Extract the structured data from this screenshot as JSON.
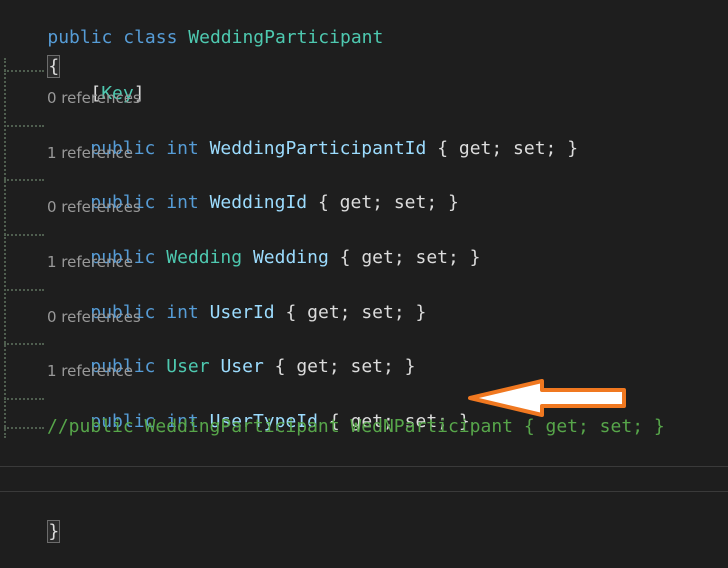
{
  "code": {
    "class_decl": {
      "kw_public": "public",
      "kw_class": "class",
      "class_name": "WeddingParticipant"
    },
    "open_brace": "{",
    "close_brace": "}",
    "attribute": {
      "open": "[",
      "name": "Key",
      "close": "]"
    },
    "lenses": {
      "wpid": "0 references",
      "weddingid": "1 reference",
      "wedding": "0 references",
      "userid": "1 reference",
      "user": "0 references",
      "usertypeid": "1 reference"
    },
    "props": {
      "wpid": {
        "mod": "public",
        "type": "int",
        "name": "WeddingParticipantId",
        "accessors": "{ get; set; }"
      },
      "weddingid": {
        "mod": "public",
        "type": "int",
        "name": "WeddingId",
        "accessors": "{ get; set; }"
      },
      "wedding": {
        "mod": "public",
        "type": "Wedding",
        "name": "Wedding",
        "accessors": "{ get; set; }"
      },
      "userid": {
        "mod": "public",
        "type": "int",
        "name": "UserId",
        "accessors": "{ get; set; }"
      },
      "user": {
        "mod": "public",
        "type": "User",
        "name": "User",
        "accessors": "{ get; set; }"
      },
      "usertypeid": {
        "mod": "public",
        "type": "int",
        "name": "UserTypeId",
        "accessors": "{ get; set; }"
      }
    },
    "comment_line": "//public WeddingParticipant WedNParticipant { get; set; }"
  },
  "colors": {
    "background": "#1e1e1e",
    "keyword": "#569cd6",
    "type": "#4ec9b0",
    "identifier": "#9cdcfe",
    "comment": "#57a64a",
    "arrow_stroke": "#f07820"
  },
  "icons": {
    "annotation": "arrow-left-icon"
  }
}
